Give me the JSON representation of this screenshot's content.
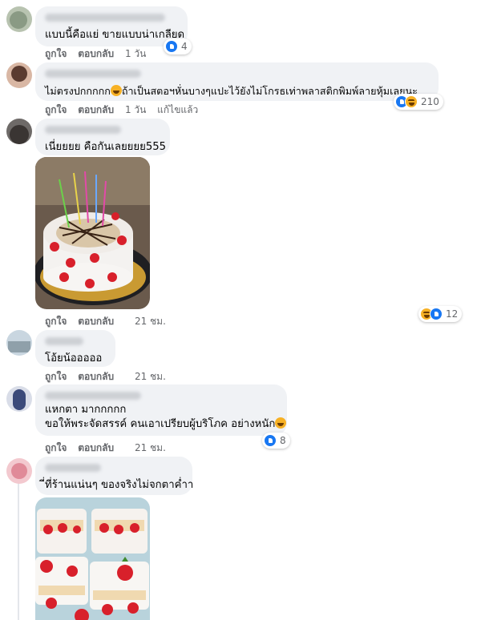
{
  "comments": [
    {
      "text": "แบบนี้คือแย่ ขายแบบน่าเกลียด",
      "like_label": "ถูกใจ",
      "reply_label": "ตอบกลับ",
      "time": "1 วัน",
      "reaction_count": "4",
      "reaction_icons": [
        "like-icon"
      ]
    },
    {
      "text": "ไม่ตรงปกกกกก",
      "text_tail": "ถ้าเป็นสตอฯหั่นบางๆแปะไว้ยังไม่โกรธเท่าพลาสติกพิมพ์ลายหุ้มเลยนะ",
      "like_label": "ถูกใจ",
      "reply_label": "ตอบกลับ",
      "time": "1 วัน",
      "edited_label": "แก้ไขแล้ว",
      "reaction_count": "210",
      "reaction_icons": [
        "like-icon",
        "haha-icon"
      ]
    },
    {
      "text": "เนี่ยยยย คือกันเลยยยย555",
      "like_label": "ถูกใจ",
      "reply_label": "ตอบกลับ",
      "time": "21 ชม.",
      "reaction_count": "12",
      "reaction_icons": [
        "haha-icon",
        "like-icon"
      ],
      "photo": "strawberry-birthday-cake-photo"
    },
    {
      "text": "โอ้ยน้อออออ",
      "like_label": "ถูกใจ",
      "reply_label": "ตอบกลับ",
      "time": "21 ชม."
    },
    {
      "text_line1": "แหกตา มากกกกก",
      "text_line2": "ขอให้พระจัดสรรค์ คนเอาเปรียบผู้บริโภค อย่างหนัก",
      "like_label": "ถูกใจ",
      "reply_label": "ตอบกลับ",
      "time": "21 ชม.",
      "reaction_count": "8",
      "reaction_icons": [
        "like-icon"
      ]
    },
    {
      "text": "ี่ที่ร้านแน่นๆ ของจริงไม่จกตาค่ำา",
      "photo": "strawberry-dessert-cups-photo"
    }
  ],
  "colors": {
    "bubble": "#f0f2f5",
    "meta_text": "#65676b",
    "like_blue": "#1877f2",
    "haha_yellow": "#f7b125"
  }
}
